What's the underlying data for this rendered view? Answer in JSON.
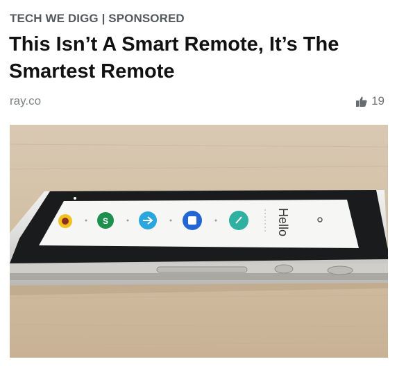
{
  "article": {
    "eyebrow": "TECH WE DIGG | SPONSORED",
    "title": "This Isn’t A Smart Remote, It’s The Smartest Remote",
    "source": "ray.co",
    "likes": "19",
    "image": {
      "screen_text": "Hello",
      "app_colors": [
        "#f2c11d",
        "#1f8f4e",
        "#2aa7df",
        "#2266d6",
        "#2fb0a0"
      ]
    }
  }
}
